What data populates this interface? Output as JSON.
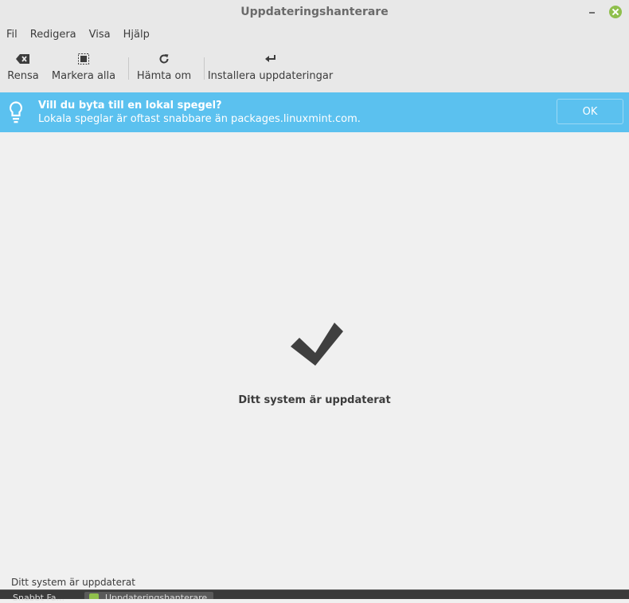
{
  "window": {
    "title": "Uppdateringshanterare"
  },
  "menu": {
    "items": [
      "Fil",
      "Redigera",
      "Visa",
      "Hjälp"
    ]
  },
  "toolbar": {
    "clear_label": "Rensa",
    "select_all_label": "Markera alla",
    "refresh_label": "Hämta om",
    "install_label": "Installera uppdateringar"
  },
  "infobar": {
    "headline": "Vill du byta till en lokal spegel?",
    "detail": "Lokala speglar är oftast snabbare än packages.linuxmint.com.",
    "ok_label": "OK",
    "color": "#5bc1ef"
  },
  "main": {
    "status_message": "Ditt system är uppdaterat"
  },
  "statusbar": {
    "text": "Ditt system är uppdaterat"
  },
  "taskbar": {
    "start_label": "Snabbt Fa...",
    "window_label": "Uppdateringshanterare"
  },
  "icons": {
    "clear": "backspace-icon",
    "select_all": "select-all-icon",
    "refresh": "refresh-icon",
    "install": "enter-arrow-icon",
    "info": "lightbulb-icon",
    "status": "checkmark-icon"
  }
}
